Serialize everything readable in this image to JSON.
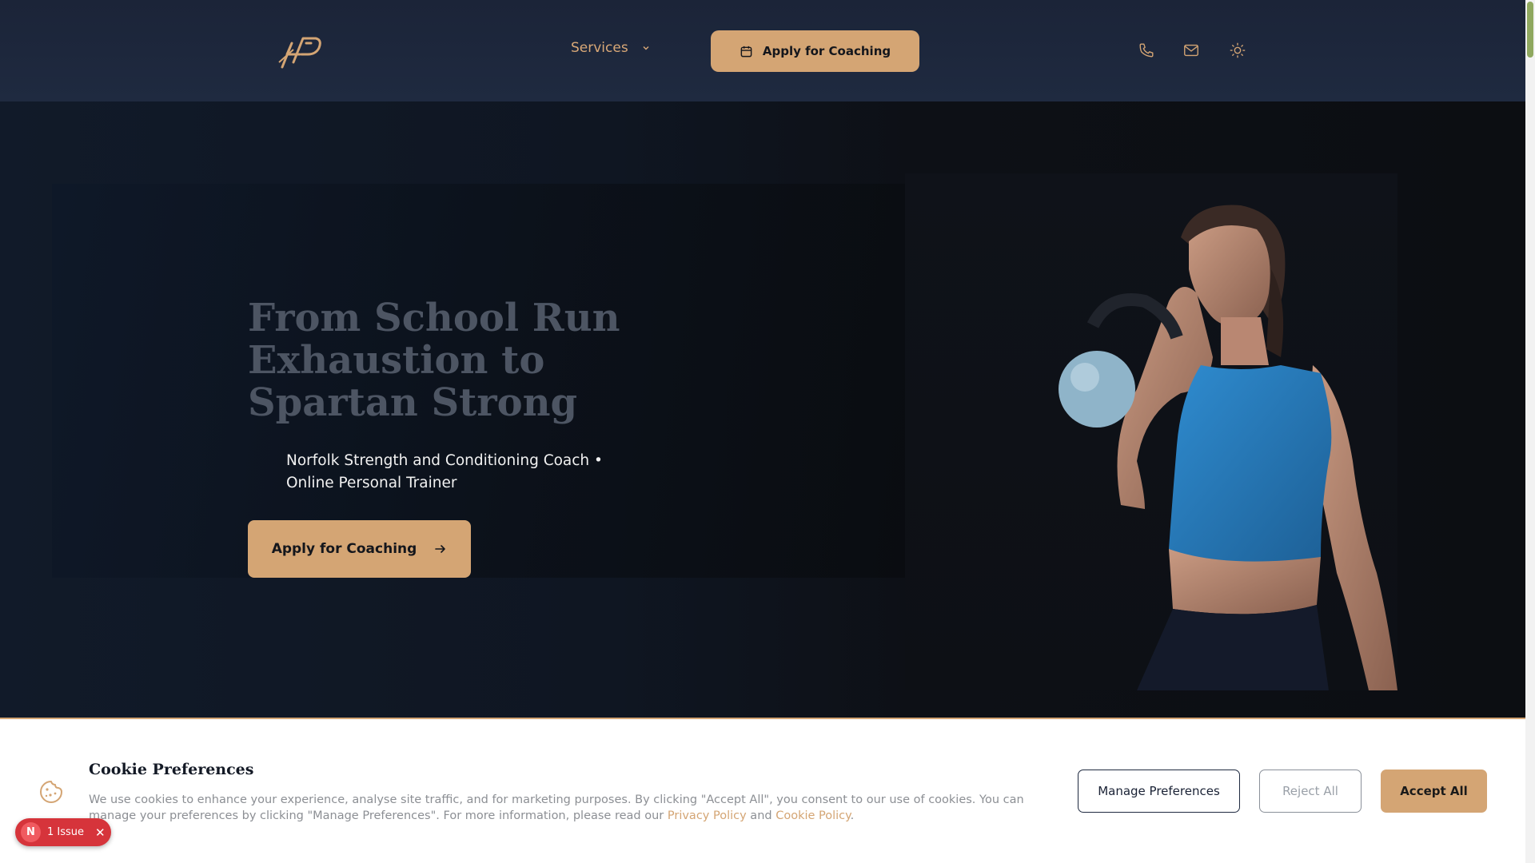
{
  "header": {
    "logo_alt": "LHP",
    "nav_services": "Services",
    "cta_label": "Apply for Coaching",
    "icons": [
      "phone-icon",
      "mail-icon",
      "sun-icon"
    ]
  },
  "hero": {
    "title": "From School Run Exhaustion to Spartan Strong",
    "subtitle": "Norfolk Strength and Conditioning Coach • Online Personal Trainer",
    "cta_label": "Apply for Coaching"
  },
  "cookie": {
    "title": "Cookie Preferences",
    "text_before": "We use cookies to enhance your experience, analyse site traffic, and for marketing purposes. By clicking \"Accept All\", you consent to our use of cookies. You can manage your preferences by clicking \"Manage Preferences\". For more information, please read our ",
    "privacy_link": "Privacy Policy",
    "and_text": " and ",
    "cookie_link": "Cookie Policy",
    "end_text": ".",
    "manage_label": "Manage Preferences",
    "reject_label": "Reject All",
    "accept_label": "Accept All"
  },
  "issue_badge": {
    "initial": "N",
    "label": "1 Issue",
    "close": "✕"
  },
  "colors": {
    "accent": "#d4a574",
    "header_bg": "#1f2a40",
    "hero_bg": "#0f141d",
    "issue_red": "#d6343b"
  }
}
